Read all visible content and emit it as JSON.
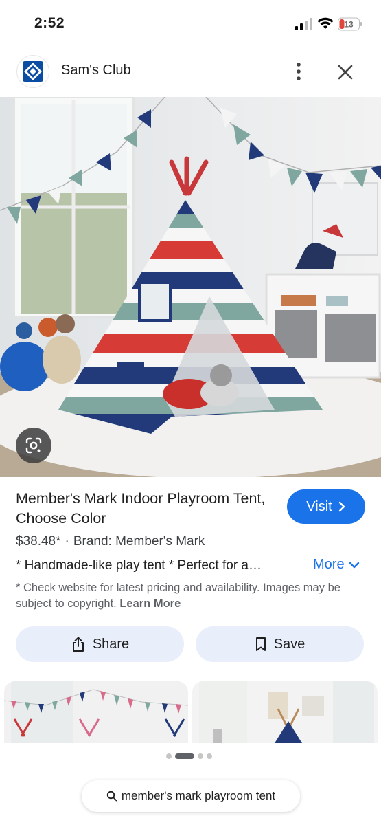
{
  "status_bar": {
    "time": "2:52",
    "battery": "13"
  },
  "header": {
    "site_name": "Sam's Club",
    "logo_icon": "sams-club-diamond-icon"
  },
  "product": {
    "title": "Member's Mark Indoor Playroom Tent, Choose Color",
    "price": "$38.48*",
    "separator": "·",
    "brand": "Brand: Member's Mark",
    "description": "* Handmade-like play tent * Perfect for a…",
    "more_label": "More",
    "disclaimer": "* Check website for latest pricing and availability. Images may be subject to copyright.",
    "learn_more": "Learn More"
  },
  "actions": {
    "visit_label": "Visit",
    "share_label": "Share",
    "save_label": "Save"
  },
  "pager": {
    "count": 4,
    "active_index": 1
  },
  "search": {
    "query": "member's mark playroom tent"
  },
  "colors": {
    "accent": "#1a73e8",
    "pill_bg": "#e8effb",
    "tent_red": "#d63b36",
    "tent_navy": "#223a7a",
    "tent_teal": "#7fa7a0"
  }
}
